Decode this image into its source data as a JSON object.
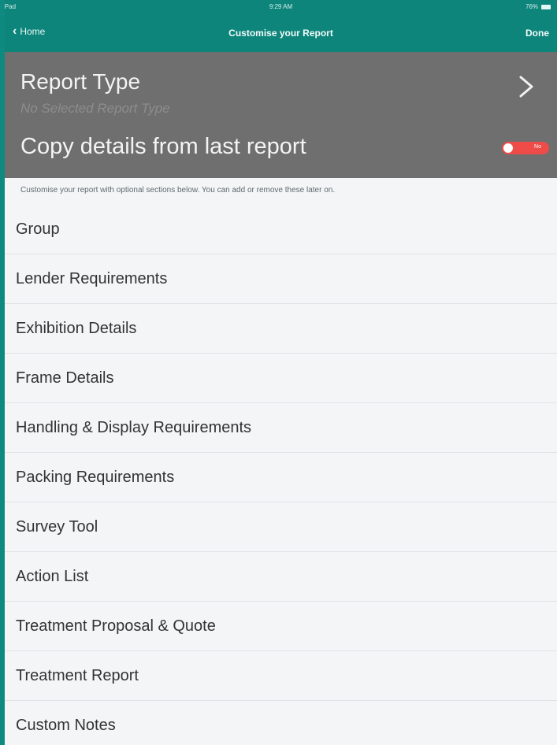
{
  "status_bar": {
    "left": "iPad",
    "time": "9:29 AM",
    "battery": "76%"
  },
  "nav": {
    "back_label": "Home",
    "title": "Customise your Report",
    "done_label": "Done"
  },
  "report_type": {
    "label": "Report Type",
    "subtitle": "No Selected Report Type"
  },
  "copy_details": {
    "label": "Copy details from last report",
    "toggle_state": "No"
  },
  "hint": "Customise your report with optional sections below. You can add or remove these later on.",
  "sections": [
    {
      "label": "Group"
    },
    {
      "label": "Lender Requirements"
    },
    {
      "label": "Exhibition Details"
    },
    {
      "label": "Frame Details"
    },
    {
      "label": "Handling & Display Requirements"
    },
    {
      "label": "Packing Requirements"
    },
    {
      "label": "Survey Tool"
    },
    {
      "label": "Action List"
    },
    {
      "label": "Treatment Proposal & Quote"
    },
    {
      "label": "Treatment Report"
    },
    {
      "label": "Custom Notes"
    }
  ],
  "colors": {
    "nav": "#0d857b",
    "header_panel": "#6f6f6f",
    "toggle_off": "#ef4b48",
    "background": "#f4f5f7"
  }
}
